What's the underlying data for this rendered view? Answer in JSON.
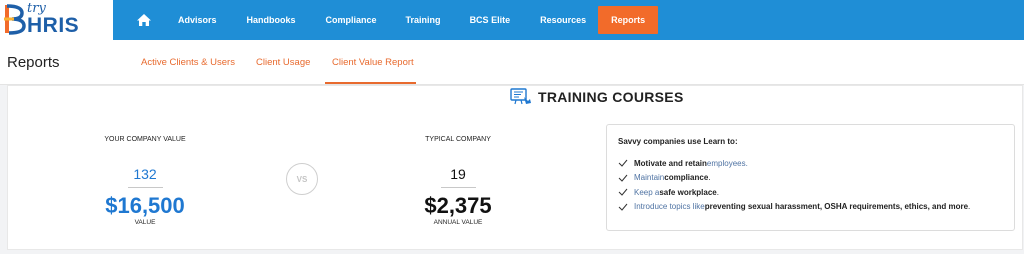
{
  "brand": {
    "try": "try",
    "name": "HRIS",
    "colors": {
      "blue": "#1e5fa8",
      "orange": "#f26b2a"
    }
  },
  "nav": {
    "home_icon": "home-icon",
    "items": [
      "Advisors",
      "Handbooks",
      "Compliance",
      "Training",
      "BCS Elite",
      "Resources"
    ],
    "active": "Reports",
    "accent": "#1f8ed6"
  },
  "page": {
    "title": "Reports"
  },
  "tabs": [
    {
      "label": "Active Clients & Users",
      "active": false
    },
    {
      "label": "Client Usage",
      "active": false
    },
    {
      "label": "Client Value Report",
      "active": true
    }
  ],
  "section": {
    "title": "TRAINING COURSES",
    "icon": "training-icon"
  },
  "your_company": {
    "label": "YOUR COMPANY VALUE",
    "count": "132",
    "amount": "$16,500",
    "amount_label": "VALUE"
  },
  "vs": "VS",
  "typical_company": {
    "label": "TYPICAL COMPANY",
    "count": "19",
    "amount": "$2,375",
    "amount_label": "ANNUAL VALUE"
  },
  "benefits": {
    "heading": "Savvy companies use Learn to:",
    "items": [
      {
        "parts": [
          "Motivate and retain",
          " employees."
        ]
      },
      {
        "parts": [
          "Maintain",
          " compliance",
          "."
        ]
      },
      {
        "parts": [
          "Keep a ",
          "safe workplace",
          "."
        ]
      },
      {
        "parts": [
          "Introduce topics like ",
          "preventing sexual harassment, OSHA requirements, ethics, and more",
          "."
        ]
      }
    ]
  }
}
